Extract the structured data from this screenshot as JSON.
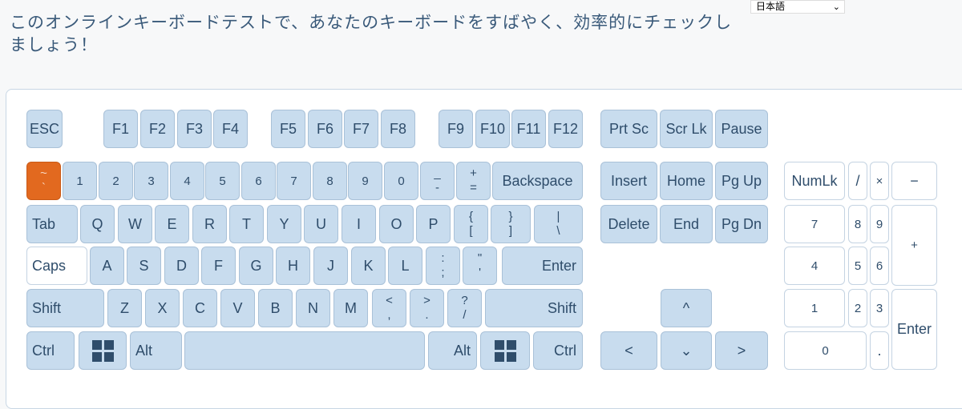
{
  "heading": "このオンラインキーボードテストで、あなたのキーボードをすばやく、効率的にチェックしましょう！",
  "language_select": {
    "value": "日本語",
    "caret": "⌄"
  },
  "function_row": [
    "ESC",
    "F1",
    "F2",
    "F3",
    "F4",
    "F5",
    "F6",
    "F7",
    "F8",
    "F9",
    "F10",
    "F11",
    "F12"
  ],
  "system_keys": [
    "Prt Sc",
    "Scr Lk",
    "Pause"
  ],
  "number_row": {
    "tilde": [
      "~",
      "`"
    ],
    "digits": [
      "1",
      "2",
      "3",
      "4",
      "5",
      "6",
      "7",
      "8",
      "9",
      "0"
    ],
    "minus": [
      "_",
      "-"
    ],
    "plus": [
      "+",
      "="
    ],
    "backspace": "Backspace"
  },
  "qwerty_row": {
    "tab": "Tab",
    "letters": [
      "Q",
      "W",
      "E",
      "R",
      "T",
      "Y",
      "U",
      "I",
      "O",
      "P"
    ],
    "brace_open": [
      "{",
      "["
    ],
    "brace_close": [
      "}",
      "]"
    ],
    "pipe": [
      "|",
      "\\"
    ]
  },
  "home_row": {
    "caps": "Caps",
    "letters": [
      "A",
      "S",
      "D",
      "F",
      "G",
      "H",
      "J",
      "K",
      "L"
    ],
    "colon": [
      ":",
      ";"
    ],
    "quote": [
      "\"",
      "'"
    ],
    "enter": "Enter"
  },
  "shift_row": {
    "shift_left": "Shift",
    "letters": [
      "Z",
      "X",
      "C",
      "V",
      "B",
      "N",
      "M"
    ],
    "lt": [
      "<",
      ","
    ],
    "gt": [
      ">",
      "."
    ],
    "question": [
      "?",
      "/"
    ],
    "shift_right": "Shift"
  },
  "bottom_row": {
    "ctrl_left": "Ctrl",
    "alt_left": "Alt",
    "space": "",
    "alt_right": "Alt",
    "ctrl_right": "Ctrl"
  },
  "nav_keys": [
    "Insert",
    "Home",
    "Pg Up",
    "Delete",
    "End",
    "Pg Dn"
  ],
  "arrows": {
    "up": "^",
    "left": "<",
    "down": "⌄",
    "right": ">"
  },
  "numpad": {
    "numlock": "NumLk",
    "divide": "/",
    "multiply": "×",
    "minus": "−",
    "seven": "7",
    "eight": "8",
    "nine": "9",
    "plus": "+",
    "four": "4",
    "five": "5",
    "six": "6",
    "one": "1",
    "two": "2",
    "three": "3",
    "enter": "Enter",
    "zero": "0",
    "decimal": "."
  },
  "key_colors": {
    "default": "#c8dcee",
    "untested": "#ffffff",
    "pressed": "#e2691f",
    "text": "#2f4d6b"
  }
}
